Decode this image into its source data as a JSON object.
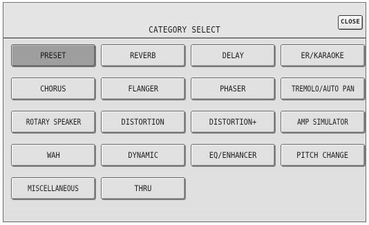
{
  "dialog": {
    "title": "CATEGORY SELECT",
    "close_label": "CLOSE"
  },
  "categories": [
    {
      "label": "PRESET",
      "selected": true
    },
    {
      "label": "REVERB",
      "selected": false
    },
    {
      "label": "DELAY",
      "selected": false
    },
    {
      "label": "ER/KARAOKE",
      "selected": false
    },
    {
      "label": "CHORUS",
      "selected": false
    },
    {
      "label": "FLANGER",
      "selected": false
    },
    {
      "label": "PHASER",
      "selected": false
    },
    {
      "label": "TREMOLO/AUTO PAN",
      "selected": false
    },
    {
      "label": "ROTARY SPEAKER",
      "selected": false
    },
    {
      "label": "DISTORTION",
      "selected": false
    },
    {
      "label": "DISTORTION+",
      "selected": false
    },
    {
      "label": "AMP SIMULATOR",
      "selected": false
    },
    {
      "label": "WAH",
      "selected": false
    },
    {
      "label": "DYNAMIC",
      "selected": false
    },
    {
      "label": "EQ/ENHANCER",
      "selected": false
    },
    {
      "label": "PITCH CHANGE",
      "selected": false
    },
    {
      "label": "MISCELLANEOUS",
      "selected": false
    },
    {
      "label": "THRU",
      "selected": false
    }
  ]
}
